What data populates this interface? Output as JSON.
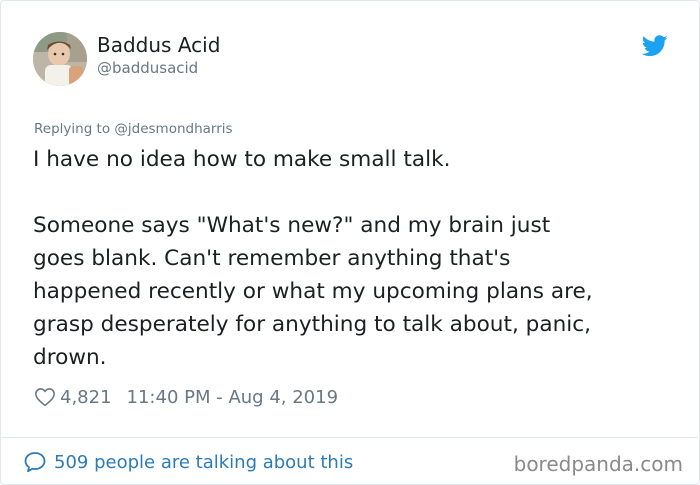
{
  "author": {
    "display_name": "Baddus Acid",
    "handle": "@baddusacid"
  },
  "icons": {
    "platform": "twitter-bird-icon",
    "like": "heart-icon",
    "conversation": "speech-bubble-icon"
  },
  "colors": {
    "brand_blue": "#1da1f2",
    "link_blue": "#2b7bb9",
    "muted_text": "#697882",
    "main_text": "#1c2022"
  },
  "tweet": {
    "replying_to": "Replying to @jdesmondharris",
    "lines_p1": [
      "I have no idea how to make small talk."
    ],
    "lines_p2": [
      "Someone says \"What's new?\" and my brain just",
      "goes blank. Can't remember anything that's",
      "happened recently or what my upcoming plans are,",
      "grasp desperately for anything to talk about, panic,",
      "drown."
    ],
    "likes": "4,821",
    "timestamp": "11:40 PM - Aug 4, 2019"
  },
  "footer": {
    "conversation_text": "509 people are talking about this",
    "watermark": "boredpanda.com"
  }
}
